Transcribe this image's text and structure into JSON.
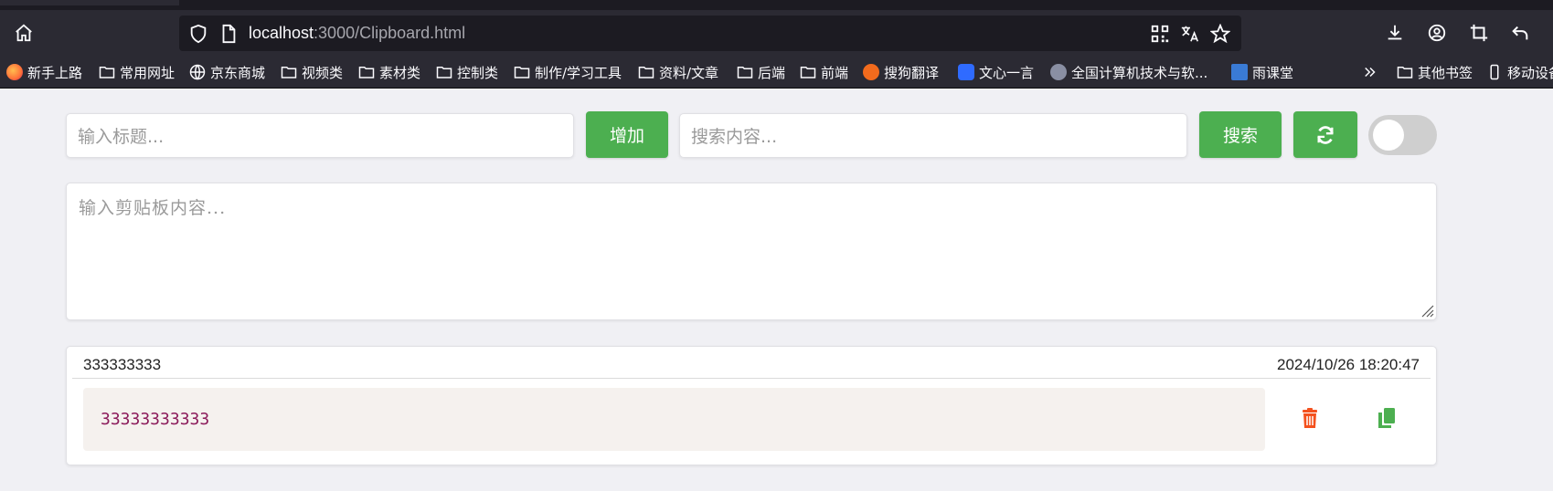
{
  "browser": {
    "url_host": "localhost",
    "url_rest": ":3000/Clipboard.html",
    "bookmarks": [
      {
        "label": "新手上路",
        "icon": "firefox-icon",
        "color": "#ff7139"
      },
      {
        "label": "常用网址",
        "icon": "folder-icon"
      },
      {
        "label": "京东商城",
        "icon": "globe-icon"
      },
      {
        "label": "视频类",
        "icon": "folder-icon"
      },
      {
        "label": "素材类",
        "icon": "folder-icon"
      },
      {
        "label": "控制类",
        "icon": "folder-icon"
      },
      {
        "label": "制作/学习工具",
        "icon": "folder-icon"
      },
      {
        "label": "资料/文章",
        "icon": "folder-icon"
      },
      {
        "label": "后端",
        "icon": "folder-icon"
      },
      {
        "label": "前端",
        "icon": "folder-icon"
      },
      {
        "label": "搜狗翻译",
        "icon": "sogou-icon",
        "color": "#f26b1d"
      },
      {
        "label": "文心一言",
        "icon": "wenxin-icon",
        "color": "#2f6bff"
      },
      {
        "label": "全国计算机技术与软...",
        "icon": "ruankao-icon",
        "color": "#9ab"
      },
      {
        "label": "雨课堂",
        "icon": "yuketang-icon",
        "color": "#3a7bd5"
      }
    ],
    "other_bookmarks": "其他书签",
    "mobile_bookmarks": "移动设备"
  },
  "form": {
    "title_placeholder": "输入标题...",
    "add_label": "增加",
    "search_placeholder": "搜索内容...",
    "search_label": "搜索",
    "content_placeholder": "输入剪贴板内容...",
    "toggle_on": false
  },
  "entries": [
    {
      "title": "333333333",
      "time": "2024/10/26 18:20:47",
      "content": "33333333333"
    }
  ],
  "colors": {
    "accent": "#4caf50",
    "delete": "#f4511e",
    "copy": "#4caf50",
    "code": "#8b1a5a"
  }
}
